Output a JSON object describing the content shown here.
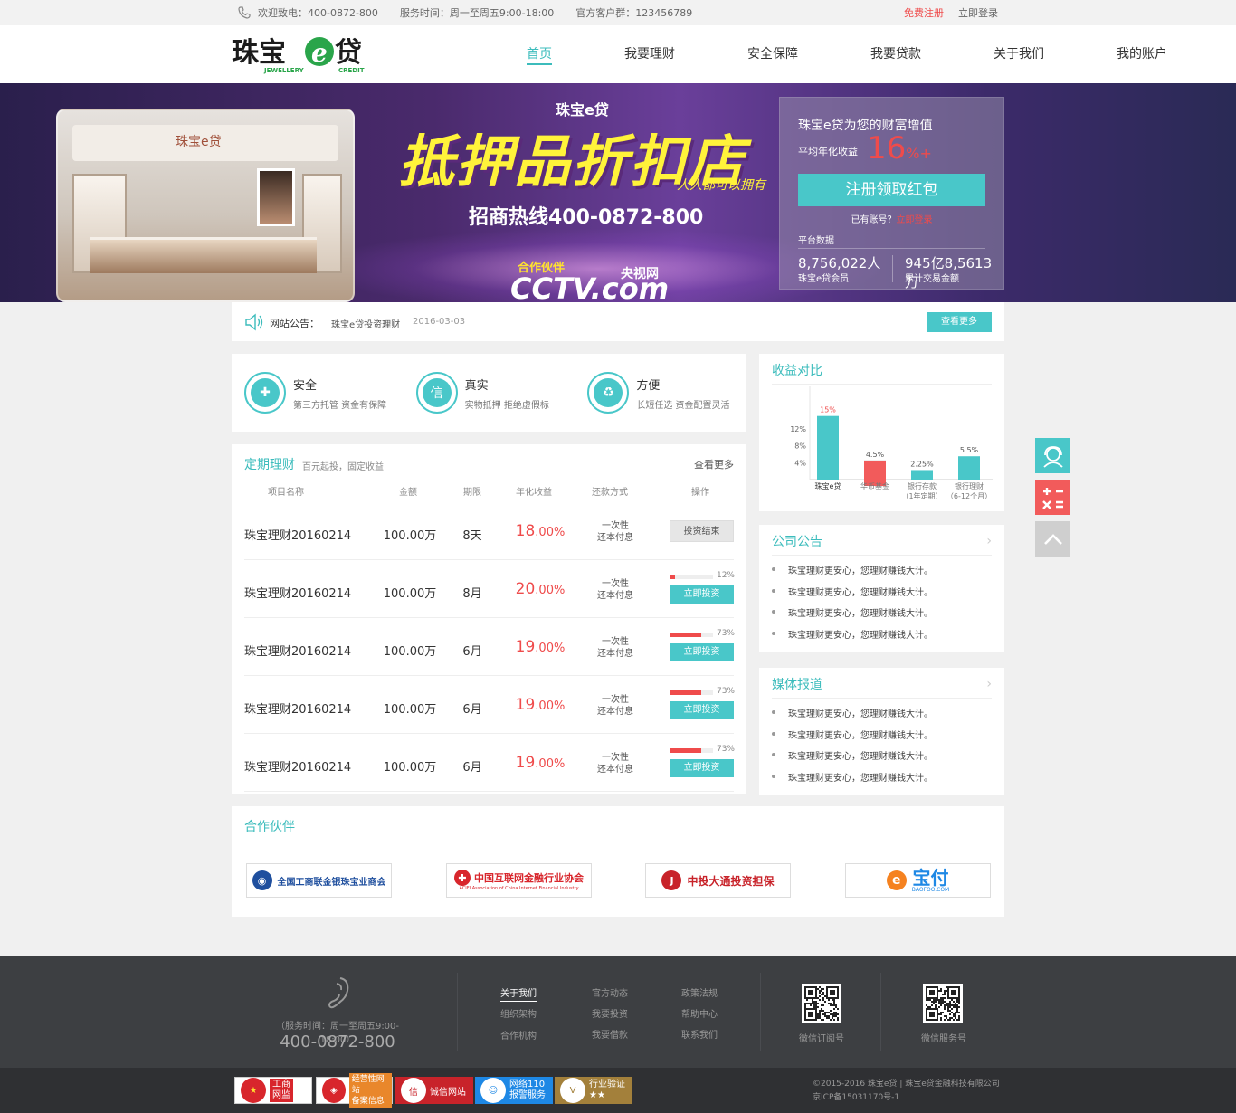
{
  "topbar": {
    "hotline": "欢迎致电：400-0872-800",
    "hours": "服务时间：周一至周五9:00-18:00",
    "qq_group": "官方客户群：123456789",
    "register": "免费注册",
    "login": "立即登录"
  },
  "brand": {
    "name": "珠宝e贷",
    "en1": "JEWELLERY",
    "en2": "CREDIT",
    "accent": "#3cbcbc",
    "red": "#ef4b4b"
  },
  "nav": [
    "首页",
    "我要理财",
    "安全保障",
    "我要贷款",
    "关于我们",
    "我的账户"
  ],
  "banner": {
    "logo": "珠宝e贷",
    "headline": "抵押品折扣店",
    "slogan": "人人都可以拥有",
    "hotline": "招商热线400-0872-800",
    "partner": "合作伙伴",
    "cctv": "CCTV.com",
    "cctv_cn": "央视网",
    "store_brand": "珠宝e贷"
  },
  "promo": {
    "title": "珠宝e贷为您的财富增值",
    "avg_label": "平均年化收益",
    "rate_num": "16",
    "rate_unit": "%+",
    "cta": "注册领取红包",
    "has_account": "已有账号？",
    "login_link": "立即登录",
    "platform_label": "平台数据",
    "members_value": "8,756,022人",
    "members_label": "珠宝e贷会员",
    "volume_value": "945亿8,5613万",
    "volume_label": "累计交易金额"
  },
  "notice": {
    "label": "网站公告：",
    "text": "珠宝e贷投资理财",
    "date": "2016-03-03",
    "more": "查看更多"
  },
  "features": [
    {
      "title": "安全",
      "desc": "第三方托管 资金有保障",
      "icon": "shield-icon",
      "glyph": "✚"
    },
    {
      "title": "真实",
      "desc": "实物抵押 拒绝虚假标",
      "icon": "trust-badge-icon",
      "glyph": "信"
    },
    {
      "title": "方便",
      "desc": "长短任选 资金配置灵活",
      "icon": "recycle-icon",
      "glyph": "♻"
    }
  ],
  "products": {
    "title": "定期理财",
    "subtitle": "百元起投，固定收益",
    "more": "查看更多",
    "headers": [
      "项目名称",
      "金额",
      "期限",
      "年化收益",
      "还款方式",
      "操作"
    ],
    "rows": [
      {
        "name": "珠宝理财20160214",
        "amount": "100.00万",
        "term": "8天",
        "rate_int": "18",
        "rate_dec": ".00%",
        "pay1": "一次性",
        "pay2": "还本付息",
        "action": "投资结束",
        "progress": null
      },
      {
        "name": "珠宝理财20160214",
        "amount": "100.00万",
        "term": "8月",
        "rate_int": "20",
        "rate_dec": ".00%",
        "pay1": "一次性",
        "pay2": "还本付息",
        "action": "立即投资",
        "progress": 12,
        "progress_label": "12%"
      },
      {
        "name": "珠宝理财20160214",
        "amount": "100.00万",
        "term": "6月",
        "rate_int": "19",
        "rate_dec": ".00%",
        "pay1": "一次性",
        "pay2": "还本付息",
        "action": "立即投资",
        "progress": 73,
        "progress_label": "73%"
      },
      {
        "name": "珠宝理财20160214",
        "amount": "100.00万",
        "term": "6月",
        "rate_int": "19",
        "rate_dec": ".00%",
        "pay1": "一次性",
        "pay2": "还本付息",
        "action": "立即投资",
        "progress": 73,
        "progress_label": "73%"
      },
      {
        "name": "珠宝理财20160214",
        "amount": "100.00万",
        "term": "6月",
        "rate_int": "19",
        "rate_dec": ".00%",
        "pay1": "一次性",
        "pay2": "还本付息",
        "action": "立即投资",
        "progress": 73,
        "progress_label": "73%"
      }
    ]
  },
  "chart_data": {
    "type": "bar",
    "title": "收益对比",
    "categories": [
      "珠宝e贷",
      "华币基金",
      "银行存款（1年定期）",
      "银行理财（6-12个月）"
    ],
    "category_lines": [
      [
        "珠宝e贷"
      ],
      [
        "华币基金"
      ],
      [
        "银行存款",
        "（1年定期）"
      ],
      [
        "银行理财",
        "（6-12个月）"
      ]
    ],
    "values": [
      15,
      4.5,
      2.25,
      5.5
    ],
    "labels": [
      "15%",
      "4.5%",
      "2.25%",
      "5.5%"
    ],
    "highlight": [
      0,
      6
    ],
    "yticks": [
      "4%",
      "8%",
      "12%"
    ],
    "ytick_values": [
      4,
      8,
      12
    ],
    "ylim": [
      0,
      16
    ],
    "colors": {
      "base": "#49c7c9",
      "highlight": "#f25b5b"
    }
  },
  "company_news": {
    "title": "公司公告",
    "items": [
      "珠宝理财更安心，您理财赚钱大计。",
      "珠宝理财更安心，您理财赚钱大计。",
      "珠宝理财更安心，您理财赚钱大计。",
      "珠宝理财更安心，您理财赚钱大计。"
    ]
  },
  "media": {
    "title": "媒体报道",
    "items": [
      "珠宝理财更安心，您理财赚钱大计。",
      "珠宝理财更安心，您理财赚钱大计。",
      "珠宝理财更安心，您理财赚钱大计。",
      "珠宝理财更安心，您理财赚钱大计。"
    ]
  },
  "partners": {
    "title": "合作伙伴",
    "logos": [
      {
        "name": "全国工商联金银珠宝业商会",
        "mark": "◉",
        "color": "#1f4f9e"
      },
      {
        "name": "中国互联网金融行业协会",
        "mark": "✚",
        "color": "#d8262c",
        "sub": "ACIFI Association of China Internet Financial Industry"
      },
      {
        "name": "中投大通投资担保",
        "mark": "J",
        "color": "#c8232a"
      },
      {
        "name": "宝付",
        "mark": "e",
        "color": "#1e88e5",
        "sub": "BAOFOO.COM"
      }
    ]
  },
  "footer": {
    "hours": "（服务时间：周一至周五9:00-18:00）",
    "tel": "400-0872-800",
    "links": [
      [
        "关于我们",
        "组织架构",
        "合作机构"
      ],
      [
        "官方动态",
        "我要投资",
        "我要借款"
      ],
      [
        "政策法规",
        "帮助中心",
        "联系我们"
      ]
    ],
    "qr1": "微信订阅号",
    "qr2": "微信服务号",
    "badges": [
      {
        "line1": "工商",
        "line2": "网监",
        "bg": "#d8262c"
      },
      {
        "line1": "经营性网站",
        "line2": "备案信息",
        "bg": "#e9872b"
      },
      {
        "line1": "诚信网站",
        "line2": "",
        "bg": "#c8232a"
      },
      {
        "line1": "网络110",
        "line2": "报警服务",
        "bg": "#1e88e5"
      },
      {
        "line1": "行业验证",
        "line2": "★★",
        "bg": "#a3803b"
      }
    ],
    "copyright": "©2015-2016  珠宝e贷  |  珠宝e贷金融科技有限公司",
    "icp": "京ICP备15031170号-1"
  },
  "side": {
    "service": "customer-service-icon",
    "calc": "calculator-icon",
    "top": "back-to-top-icon"
  }
}
